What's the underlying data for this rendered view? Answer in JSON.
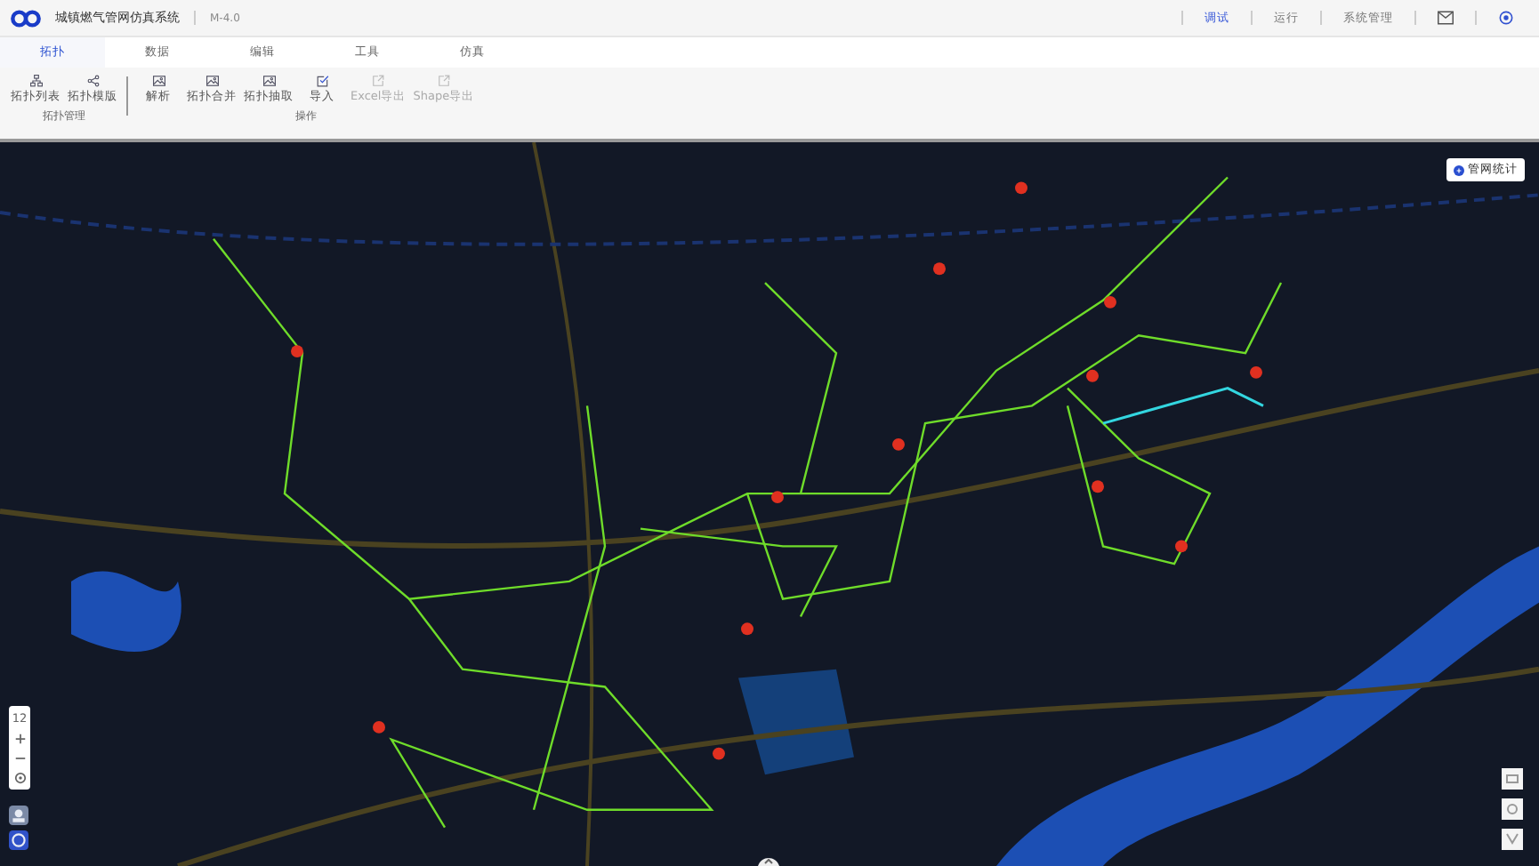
{
  "header": {
    "title": "城镇燃气管网仿真系统",
    "version": "M-4.0",
    "modes": [
      {
        "label": "调试",
        "selected": true
      },
      {
        "label": "运行",
        "selected": false
      }
    ],
    "admin": "系统管理"
  },
  "tabs": [
    {
      "label": "拓扑",
      "selected": true
    },
    {
      "label": "数据",
      "selected": false
    },
    {
      "label": "编辑",
      "selected": false
    },
    {
      "label": "工具",
      "selected": false
    },
    {
      "label": "仿真",
      "selected": false
    }
  ],
  "toolbar": {
    "groups": [
      {
        "label": "拓扑管理",
        "items": [
          {
            "label": "拓扑列表",
            "kind": "tree",
            "disabled": false
          },
          {
            "label": "拓扑模版",
            "kind": "share",
            "disabled": false
          }
        ]
      },
      {
        "label": "操作",
        "items": [
          {
            "label": "解析",
            "kind": "image",
            "disabled": false
          },
          {
            "label": "拓扑合并",
            "kind": "image",
            "disabled": false
          },
          {
            "label": "拓扑抽取",
            "kind": "image",
            "disabled": false
          },
          {
            "label": "导入",
            "kind": "check",
            "disabled": false
          },
          {
            "label": "Excel导出",
            "kind": "export",
            "disabled": true
          },
          {
            "label": "Shape导出",
            "kind": "export",
            "disabled": true
          }
        ]
      }
    ]
  },
  "map": {
    "stats_button": "管网统计",
    "zoom_level": "12"
  }
}
